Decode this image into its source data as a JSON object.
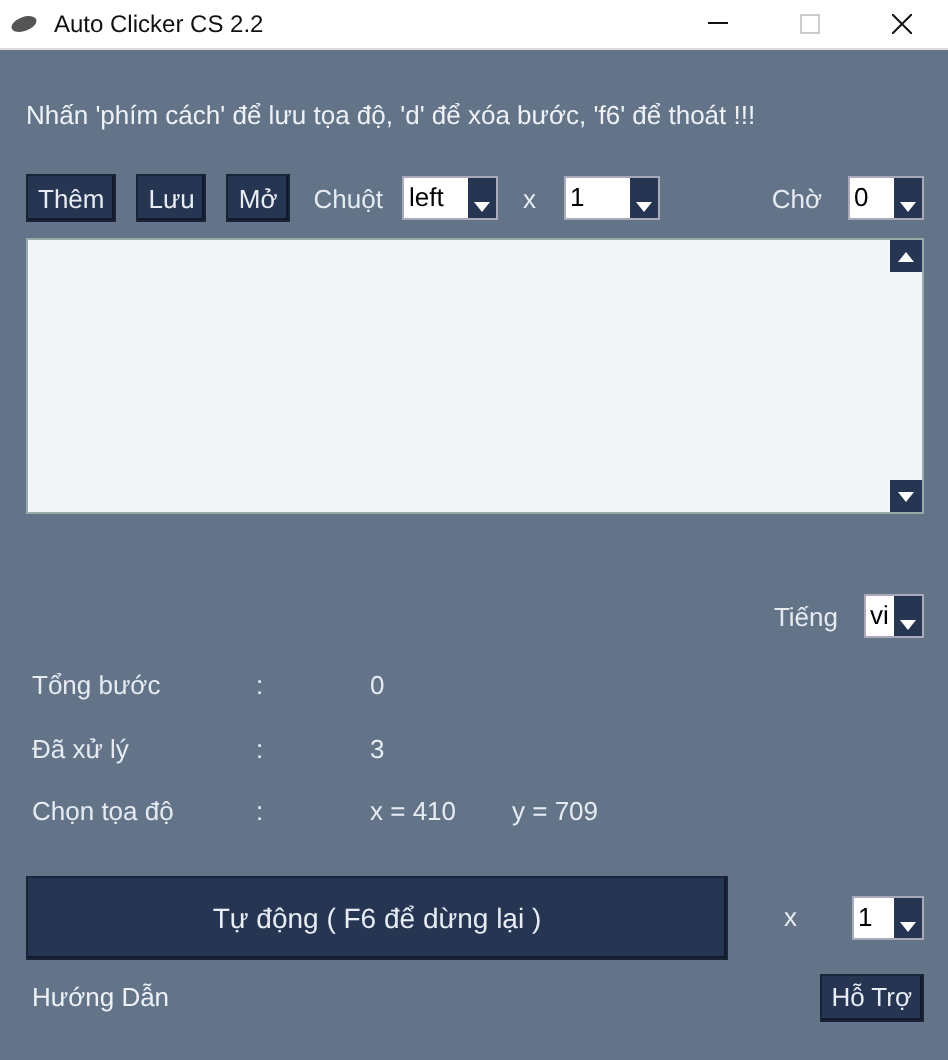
{
  "window": {
    "title": "Auto Clicker CS 2.2",
    "maximize_disabled": true
  },
  "instruction": "Nhấn 'phím cách' để lưu tọa độ, 'd' để xóa bước, 'f6' để thoát !!!",
  "toolbar": {
    "buttons": [
      "Thêm",
      "Lưu",
      "Mở"
    ],
    "mouse_label": "Chuột",
    "mouse_value": "left",
    "times_label": "x",
    "times_value": "1",
    "wait_label": "Chờ",
    "wait_value": "0"
  },
  "language": {
    "label": "Tiếng",
    "value": "vi"
  },
  "stats": [
    {
      "label": "Tổng bước",
      "separator": ":",
      "values": [
        "0"
      ]
    },
    {
      "label": "Đã xử lý",
      "separator": ":",
      "values": [
        "3"
      ]
    },
    {
      "label": "Chọn tọa độ",
      "separator": ":",
      "values": [
        "x = 410",
        "y = 709"
      ]
    }
  ],
  "run": {
    "button": "Tự động ( F6 để dừng lại )",
    "times_label": "x",
    "times_value": "1"
  },
  "footer": {
    "guide": "Hướng Dẫn",
    "support": "Hỗ Trợ"
  }
}
